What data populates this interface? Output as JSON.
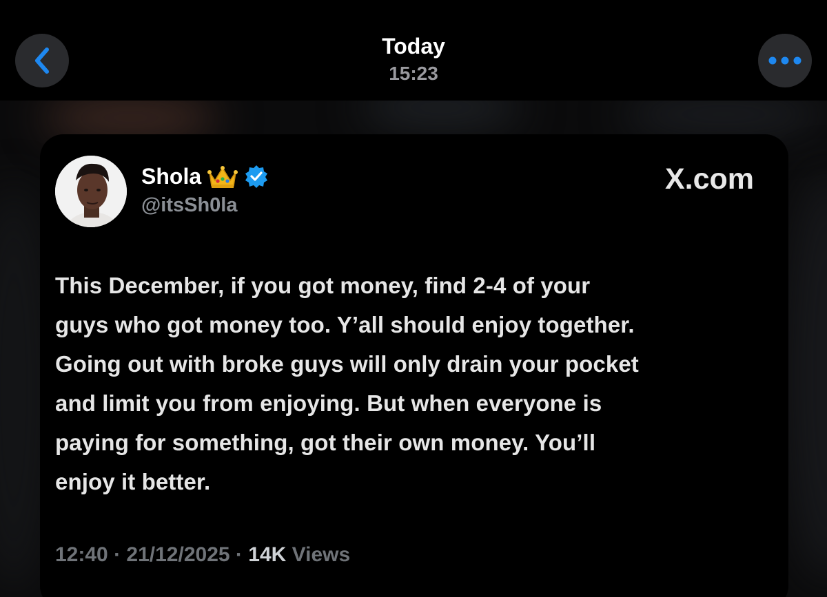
{
  "nav": {
    "title": "Today",
    "subtitle": "15:23",
    "back_icon": "chevron-left-icon",
    "more_icon": "ellipsis-icon",
    "accent_color": "#1e88f0"
  },
  "tweet": {
    "display_name": "Shola",
    "badge_icons": [
      "crown-emoji-icon",
      "verified-badge-icon"
    ],
    "handle": "@itsSh0la",
    "source": "X.com",
    "text_lines": [
      "This December, if you got money, find 2-4 of your",
      "guys who got money too. Y’all should enjoy together.",
      "Going out with broke guys will only drain your pocket",
      "and limit you from enjoying. But when everyone is",
      "paying for something, got their own money. You’ll",
      "enjoy it better."
    ],
    "time": "12:40",
    "separator": "·",
    "date": "21/12/2025",
    "views_count": "14K",
    "views_label": "Views"
  }
}
